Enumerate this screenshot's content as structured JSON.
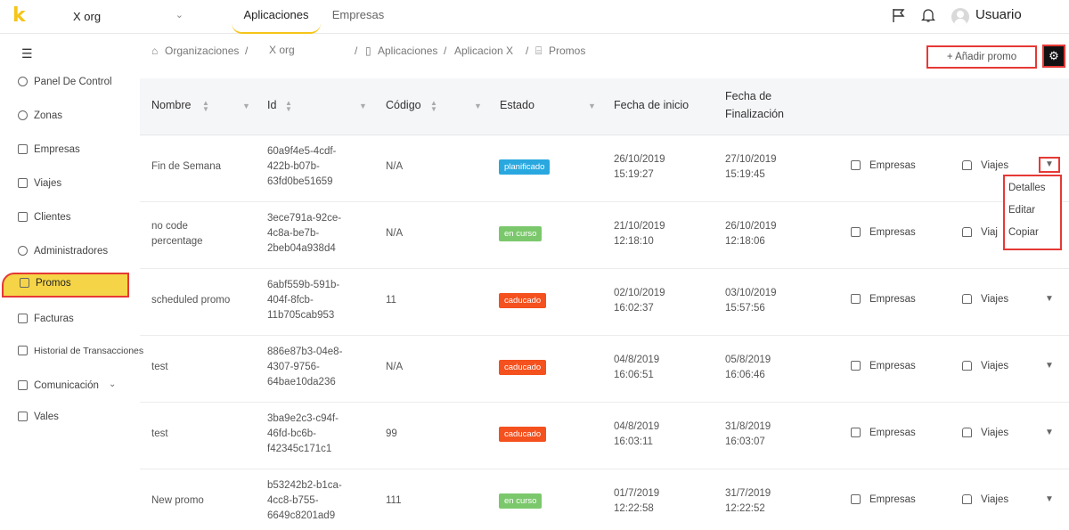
{
  "topbar": {
    "logo": "k",
    "org_name": "X org",
    "org_chevron": "⌄",
    "tabs": [
      {
        "label": "Aplicaciones",
        "active": true
      },
      {
        "label": "Empresas",
        "active": false
      }
    ],
    "icons": [
      "flag-icon",
      "bell-icon"
    ],
    "user": "Usuario"
  },
  "sidebar": {
    "collapse_icon": "menu-collapse-icon",
    "items": [
      {
        "label": "Panel De Control",
        "icon": "dashboard-icon"
      },
      {
        "label": "Zonas",
        "icon": "location-icon"
      },
      {
        "label": "Empresas",
        "icon": "building-icon"
      },
      {
        "label": "Viajes",
        "icon": "car-icon"
      },
      {
        "label": "Clientes",
        "icon": "id-card-icon"
      },
      {
        "label": "Administradores",
        "icon": "admin-icon"
      },
      {
        "label": "Promos",
        "icon": "gift-icon",
        "active": true
      },
      {
        "label": "Facturas",
        "icon": "invoice-icon"
      },
      {
        "label": "Historial de Transacciones",
        "icon": "edit-icon"
      },
      {
        "label": "Comunicación",
        "icon": "chat-icon",
        "expandable": true
      },
      {
        "label": "Vales",
        "icon": "gift-icon"
      }
    ]
  },
  "breadcrumb": {
    "home_icon": "⌂",
    "organizaciones": "Organizaciones",
    "sep": "/",
    "org": "X org",
    "app_icon": "▯",
    "aplicaciones": "Aplicaciones",
    "app": "Aplicacion X",
    "promos_icon": "⌸",
    "promos": "Promos"
  },
  "toolbar": {
    "add_label": "+ Añadir promo",
    "settings_icon": "⚙"
  },
  "table": {
    "headers": {
      "nombre": "Nombre",
      "id": "Id",
      "codigo": "Código",
      "estado": "Estado",
      "fecha_inicio": "Fecha de inicio",
      "fecha_fin_1": "Fecha de",
      "fecha_fin_2": "Finalización"
    },
    "rows": [
      {
        "nombre": [
          "Fin de Semana"
        ],
        "id": [
          "60a9f4e5-4cdf-",
          "422b-b07b-",
          "63fd0be51659"
        ],
        "codigo": "N/A",
        "estado": "planificado",
        "estado_color": "#29a8e0",
        "inicio": [
          "26/10/2019",
          "15:19:27"
        ],
        "fin": [
          "27/10/2019",
          "15:19:45"
        ],
        "empresas": "Empresas",
        "viajes": "Viajes"
      },
      {
        "nombre": [
          "no code",
          "percentage"
        ],
        "id": [
          "3ece791a-92ce-",
          "4c8a-be7b-",
          "2beb04a938d4"
        ],
        "codigo": "N/A",
        "estado": "en curso",
        "estado_color": "#7bc86c",
        "inicio": [
          "21/10/2019",
          "12:18:10"
        ],
        "fin": [
          "26/10/2019",
          "12:18:06"
        ],
        "empresas": "Empresas",
        "viajes": "Viaj"
      },
      {
        "nombre": [
          "scheduled promo"
        ],
        "id": [
          "6abf559b-591b-",
          "404f-8fcb-",
          "11b705cab953"
        ],
        "codigo": "11",
        "estado": "caducado",
        "estado_color": "#f4511e",
        "inicio": [
          "02/10/2019",
          "16:02:37"
        ],
        "fin": [
          "03/10/2019",
          "15:57:56"
        ],
        "empresas": "Empresas",
        "viajes": "Viajes"
      },
      {
        "nombre": [
          "test"
        ],
        "id": [
          "886e87b3-04e8-",
          "4307-9756-",
          "64bae10da236"
        ],
        "codigo": "N/A",
        "estado": "caducado",
        "estado_color": "#f4511e",
        "inicio": [
          "04/8/2019",
          "16:06:51"
        ],
        "fin": [
          "05/8/2019",
          "16:06:46"
        ],
        "empresas": "Empresas",
        "viajes": "Viajes"
      },
      {
        "nombre": [
          "test"
        ],
        "id": [
          "3ba9e2c3-c94f-",
          "46fd-bc6b-",
          "f42345c171c1"
        ],
        "codigo": "99",
        "estado": "caducado",
        "estado_color": "#f4511e",
        "inicio": [
          "04/8/2019",
          "16:03:11"
        ],
        "fin": [
          "31/8/2019",
          "16:03:07"
        ],
        "empresas": "Empresas",
        "viajes": "Viajes"
      },
      {
        "nombre": [
          "New promo"
        ],
        "id": [
          "b53242b2-b1ca-",
          "4cc8-b755-",
          "6649c8201ad9"
        ],
        "codigo": "111",
        "estado": "en curso",
        "estado_color": "#7bc86c",
        "inicio": [
          "01/7/2019",
          "12:22:58"
        ],
        "fin": [
          "31/7/2019",
          "12:22:52"
        ],
        "empresas": "Empresas",
        "viajes": "Viajes"
      }
    ]
  },
  "row_menu": {
    "items": [
      "Detalles",
      "Editar",
      "Copiar"
    ]
  }
}
